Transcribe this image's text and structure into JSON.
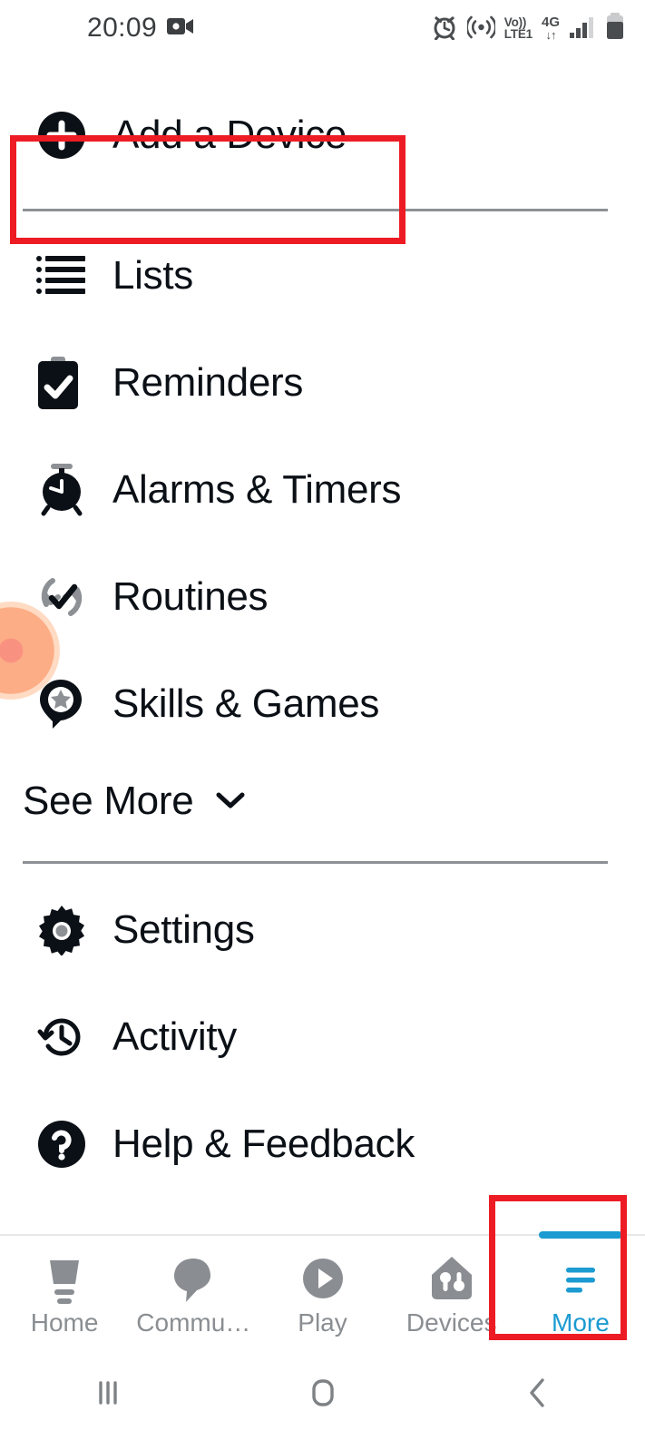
{
  "status_bar": {
    "time": "20:09",
    "left_icons": [
      "video-camera-icon"
    ],
    "right_icons": [
      "alarm-icon",
      "hotspot-icon",
      "volte-icon",
      "network-4g-icon",
      "signal-bars-icon",
      "battery-icon"
    ],
    "volte_top": "Vo))",
    "volte_bottom": "LTE1",
    "network_label": "4G",
    "network_arrows": "↓↑"
  },
  "menu": {
    "add_device": {
      "label": "Add a Device",
      "icon": "plus-circle-icon"
    },
    "primary_items": [
      {
        "label": "Lists",
        "icon": "list-icon"
      },
      {
        "label": "Reminders",
        "icon": "clipboard-check-icon"
      },
      {
        "label": "Alarms & Timers",
        "icon": "alarm-clock-icon"
      },
      {
        "label": "Routines",
        "icon": "routines-refresh-check-icon"
      },
      {
        "label": "Skills & Games",
        "icon": "skills-pin-star-icon"
      }
    ],
    "see_more": {
      "label": "See More",
      "icon": "chevron-down-icon"
    },
    "secondary_items": [
      {
        "label": "Settings",
        "icon": "gear-icon"
      },
      {
        "label": "Activity",
        "icon": "history-clock-icon"
      },
      {
        "label": "Help & Feedback",
        "icon": "question-circle-icon"
      }
    ]
  },
  "bottom_nav": {
    "tabs": [
      {
        "label": "Home",
        "icon": "echo-speaker-icon",
        "active": false
      },
      {
        "label": "Commu…",
        "icon": "chat-bubble-icon",
        "active": false
      },
      {
        "label": "Play",
        "icon": "play-circle-icon",
        "active": false
      },
      {
        "label": "Devices",
        "icon": "house-devices-icon",
        "active": false
      },
      {
        "label": "More",
        "icon": "hamburger-menu-icon",
        "active": true
      }
    ],
    "active_color": "#1b9bd1",
    "inactive_color": "#8a8e92"
  },
  "android_nav": {
    "buttons": [
      {
        "name": "recents-button",
        "icon": "recents-icon"
      },
      {
        "name": "home-button",
        "icon": "home-square-icon"
      },
      {
        "name": "back-button",
        "icon": "back-chevron-icon"
      }
    ]
  },
  "annotations": {
    "highlight_color": "#ed1c24",
    "boxes": [
      "add-a-device-highlight",
      "more-tab-highlight"
    ],
    "touch_indicator": {
      "color": "#fca97f",
      "center_color": "#f98b7a"
    }
  }
}
